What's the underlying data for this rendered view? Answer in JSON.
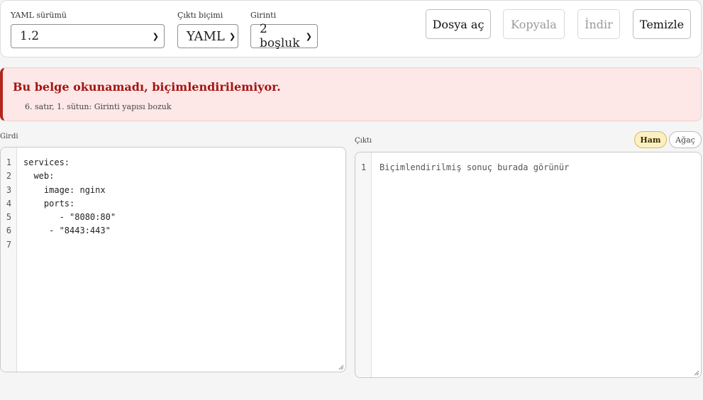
{
  "controls": {
    "yaml_version": {
      "label": "YAML sürümü",
      "value": "1.2"
    },
    "output_format": {
      "label": "Çıktı biçimi",
      "value": "YAML"
    },
    "indent": {
      "label": "Girinti",
      "value": "2 boşluk"
    }
  },
  "buttons": {
    "open": "Dosya aç",
    "copy": "Kopyala",
    "download": "İndir",
    "clear": "Temizle"
  },
  "error": {
    "title": "Bu belge okunamadı, biçimlendirilemiyor.",
    "detail": "6. satır, 1. sütun: Girinti yapısı bozuk"
  },
  "input": {
    "label": "Girdi",
    "line_numbers": [
      "1",
      "2",
      "3",
      "4",
      "5",
      "6",
      "7"
    ],
    "lines": [
      "services:",
      "  web:",
      "    image: nginx",
      "    ports:",
      "       - \"8080:80\"",
      "     - \"8443:443\"",
      ""
    ]
  },
  "output": {
    "label": "Çıktı",
    "view_raw": "Ham",
    "view_tree": "Ağaç",
    "line_numbers": [
      "1"
    ],
    "lines": [
      "Biçimlendirilmiş sonuç burada görünür"
    ]
  }
}
